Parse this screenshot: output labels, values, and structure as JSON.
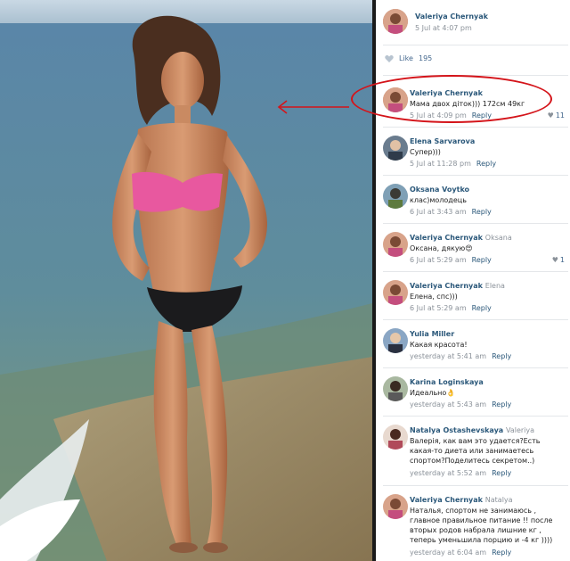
{
  "post": {
    "author": "Valeriya Chernyak",
    "date": "5 Jul at 4:07 pm",
    "like_label": "Like",
    "like_count": "195"
  },
  "comments": [
    {
      "name": "Valeriya Chernyak",
      "to": "",
      "text": [
        "Мама двох діток))) 172см 49кг"
      ],
      "time": "5 Jul at 4:09 pm",
      "reply": "Reply",
      "likes": "11"
    },
    {
      "name": "Elena Sarvarova",
      "to": "",
      "text": [
        "Супер)))"
      ],
      "time": "5 Jul at 11:28 pm",
      "reply": "Reply",
      "likes": ""
    },
    {
      "name": "Oksana Voytko",
      "to": "",
      "text": [
        "клас)молодець"
      ],
      "time": "6 Jul at 3:43 am",
      "reply": "Reply",
      "likes": ""
    },
    {
      "name": "Valeriya Chernyak",
      "to": "Oksana",
      "text": [
        "Оксана, дякую😍"
      ],
      "time": "6 Jul at 5:29 am",
      "reply": "Reply",
      "likes": "1"
    },
    {
      "name": "Valeriya Chernyak",
      "to": "Elena",
      "text": [
        "Елена, спс)))"
      ],
      "time": "6 Jul at 5:29 am",
      "reply": "Reply",
      "likes": ""
    },
    {
      "name": "Yulia Miller",
      "to": "",
      "text": [
        "Какая красота!"
      ],
      "time": "yesterday at 5:41 am",
      "reply": "Reply",
      "likes": ""
    },
    {
      "name": "Karina Loginskaya",
      "to": "",
      "text": [
        "Идеально👌"
      ],
      "time": "yesterday at 5:43 am",
      "reply": "Reply",
      "likes": ""
    },
    {
      "name": "Natalya Ostashevskaya",
      "to": "Valeriya",
      "text": [
        "Валерія, как вам это удается?Есть",
        "какая-то диета или занимаетесь",
        "спортом?Поделитесь секретом..)"
      ],
      "time": "yesterday at 5:52 am",
      "reply": "Reply",
      "likes": ""
    },
    {
      "name": "Valeriya Chernyak",
      "to": "Natalya",
      "text": [
        "Наталья, спортом не занимаюсь ,",
        "главное правильное питание !! после",
        "вторых родов набрала лишние кг ,",
        "теперь уменьшила порцию и -4 кг ))))"
      ],
      "time": "yesterday at 6:04 am",
      "reply": "Reply",
      "likes": ""
    }
  ],
  "colors": {
    "link": "#2b587a",
    "highlight": "#d4141a"
  }
}
